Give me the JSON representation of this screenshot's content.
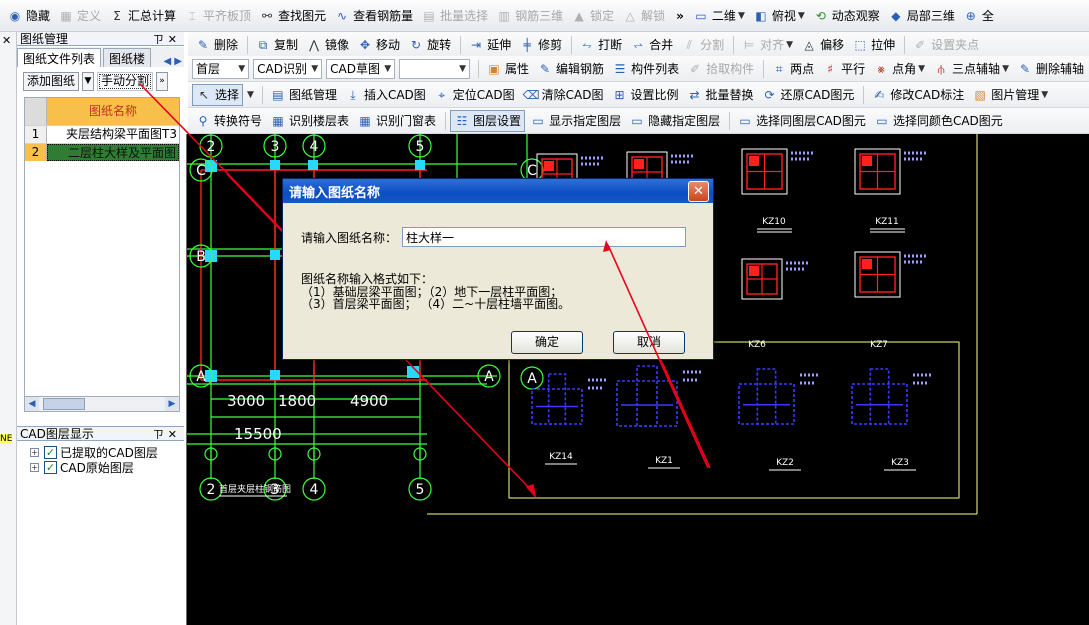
{
  "toolbar_main": [
    {
      "label": "隐藏",
      "icon": "eye-icon",
      "disabled": false
    },
    {
      "label": "定义",
      "icon": "table-icon",
      "disabled": true
    },
    {
      "label": "汇总计算",
      "icon": "sigma-icon",
      "disabled": false
    },
    {
      "label": "平齐板顶",
      "icon": "level-icon",
      "disabled": true
    },
    {
      "label": "查找图元",
      "icon": "binoculars-icon",
      "disabled": false
    },
    {
      "label": "查看钢筋量",
      "icon": "rebar-icon",
      "disabled": false
    },
    {
      "label": "批量选择",
      "icon": "batch-icon",
      "disabled": true
    },
    {
      "label": "钢筋三维",
      "icon": "rebar3d-icon",
      "disabled": true
    },
    {
      "label": "锁定",
      "icon": "lock-icon",
      "disabled": true
    },
    {
      "label": "解锁",
      "icon": "unlock-icon",
      "disabled": true
    },
    {
      "label": "二维",
      "icon": "view2d-icon",
      "disabled": false
    },
    {
      "label": "俯视",
      "icon": "topview-icon",
      "disabled": false
    },
    {
      "label": "动态观察",
      "icon": "orbit-icon",
      "disabled": false
    },
    {
      "label": "局部三维",
      "icon": "local3d-icon",
      "disabled": false
    },
    {
      "label": "全",
      "icon": "zoom-icon",
      "disabled": false
    }
  ],
  "toolbar_edit": [
    {
      "label": "删除",
      "icon": "delete-icon",
      "disabled": false
    },
    {
      "label": "复制",
      "icon": "copy-icon",
      "disabled": false
    },
    {
      "label": "镜像",
      "icon": "mirror-icon",
      "disabled": false
    },
    {
      "label": "移动",
      "icon": "move-icon",
      "disabled": false
    },
    {
      "label": "旋转",
      "icon": "rotate-icon",
      "disabled": false
    },
    {
      "label": "延伸",
      "icon": "extend-icon",
      "disabled": false
    },
    {
      "label": "修剪",
      "icon": "trim-icon",
      "disabled": false
    },
    {
      "label": "打断",
      "icon": "break-icon",
      "disabled": false
    },
    {
      "label": "合并",
      "icon": "merge-icon",
      "disabled": false
    },
    {
      "label": "分割",
      "icon": "split-icon",
      "disabled": true
    },
    {
      "label": "对齐",
      "icon": "align-icon",
      "disabled": true
    },
    {
      "label": "偏移",
      "icon": "offset-icon",
      "disabled": false
    },
    {
      "label": "拉伸",
      "icon": "stretch-icon",
      "disabled": false
    },
    {
      "label": "设置夹点",
      "icon": "grip-icon",
      "disabled": true
    }
  ],
  "toolbar_floor": {
    "floor_value": "首层",
    "cad_identify": "CAD识别",
    "cad_draft": "CAD草图",
    "empty_value": "",
    "buttons": [
      {
        "label": "属性",
        "icon": "property-icon",
        "disabled": false
      },
      {
        "label": "编辑钢筋",
        "icon": "edit-rebar-icon",
        "disabled": false
      },
      {
        "label": "构件列表",
        "icon": "list-icon",
        "disabled": false
      },
      {
        "label": "拾取构件",
        "icon": "pick-icon",
        "disabled": true
      },
      {
        "label": "两点",
        "icon": "two-point-icon",
        "disabled": false
      },
      {
        "label": "平行",
        "icon": "parallel-icon",
        "disabled": false
      },
      {
        "label": "点角",
        "icon": "point-angle-icon",
        "disabled": false
      },
      {
        "label": "三点辅轴",
        "icon": "three-point-icon",
        "disabled": false
      },
      {
        "label": "删除辅轴",
        "icon": "delete-axis-icon",
        "disabled": false
      }
    ]
  },
  "toolbar_cad": [
    {
      "label": "选择",
      "icon": "cursor-icon",
      "disabled": false,
      "active": true
    },
    {
      "label": "图纸管理",
      "icon": "drawing-manage-icon",
      "disabled": false
    },
    {
      "label": "插入CAD图",
      "icon": "insert-cad-icon",
      "disabled": false
    },
    {
      "label": "定位CAD图",
      "icon": "locate-cad-icon",
      "disabled": false
    },
    {
      "label": "清除CAD图",
      "icon": "clear-cad-icon",
      "disabled": false
    },
    {
      "label": "设置比例",
      "icon": "scale-icon",
      "disabled": false
    },
    {
      "label": "批量替换",
      "icon": "replace-icon",
      "disabled": false
    },
    {
      "label": "还原CAD图元",
      "icon": "restore-icon",
      "disabled": false
    },
    {
      "label": "修改CAD标注",
      "icon": "annotation-icon",
      "disabled": false
    },
    {
      "label": "图片管理",
      "icon": "image-manage-icon",
      "disabled": false
    }
  ],
  "toolbar_layer": [
    {
      "label": "转换符号",
      "icon": "symbol-icon",
      "disabled": false
    },
    {
      "label": "识别楼层表",
      "icon": "floor-table-icon",
      "disabled": false
    },
    {
      "label": "识别门窗表",
      "icon": "door-window-icon",
      "disabled": false
    },
    {
      "label": "图层设置",
      "icon": "layer-icon",
      "disabled": false,
      "active": true
    },
    {
      "label": "显示指定图层",
      "icon": "show-layer-icon",
      "disabled": false
    },
    {
      "label": "隐藏指定图层",
      "icon": "hide-layer-icon",
      "disabled": false
    },
    {
      "label": "选择同图层CAD图元",
      "icon": "same-layer-icon",
      "disabled": false
    },
    {
      "label": "选择同颜色CAD图元",
      "icon": "same-color-icon",
      "disabled": false
    }
  ],
  "left_panel": {
    "title": "图纸管理",
    "pin": "ㄗ",
    "close": "✕",
    "tabs": [
      "图纸文件列表",
      "图纸楼"
    ],
    "tab_nav": "◀ ▶",
    "strip_label": "NE",
    "add_button": "添加图纸",
    "split_button": "手动分割",
    "more": "»",
    "column_name": "图纸名称",
    "rows": [
      {
        "num": "1",
        "name": "夹层结构梁平面图T3"
      },
      {
        "num": "2",
        "name": "二层柱大样及平面图"
      }
    ]
  },
  "cad_layers": {
    "title": "CAD图层显示",
    "pin": "ㄗ",
    "close": "✕",
    "items": [
      "已提取的CAD图层",
      "CAD原始图层"
    ]
  },
  "canvas": {
    "axis_labels_top": [
      "2",
      "3",
      "4",
      "5"
    ],
    "axis_labels_left": [
      "C",
      "B",
      "A"
    ],
    "axis_labels_mid": [
      "A",
      "A",
      "C"
    ],
    "axis_labels_bottom": [
      "2",
      "3",
      "4",
      "5"
    ],
    "dims": [
      "3000",
      "1800",
      "4900",
      "15500"
    ],
    "sheet_title": "首层夹层柱钢筋图",
    "columns": [
      "KZ10",
      "KZ11",
      "KZ6",
      "KZ7",
      "KZ14",
      "KZ1",
      "KZ2",
      "KZ3"
    ]
  },
  "dialog": {
    "title": "请输入图纸名称",
    "close": "✕",
    "label": "请输入图纸名称：",
    "value": "柱大样一",
    "hint_lines": [
      "图纸名称输入格式如下：",
      "（1）基础层梁平面图；（2）地下一层柱平面图；",
      "（3）首层梁平面图；  （4）二~十层柱墙平面图。"
    ],
    "ok": "确定",
    "cancel": "取消"
  },
  "colors": {
    "cad_green": "#3cff3c",
    "cad_red": "#ff2020",
    "cad_blue": "#3a3aff",
    "cad_yellow": "#ffff80",
    "annotation_arrow": "#e8001c",
    "dialog_title": "#0b4ec2",
    "selected_row": "#2e7d32",
    "header_orange": "#f6c04a"
  }
}
